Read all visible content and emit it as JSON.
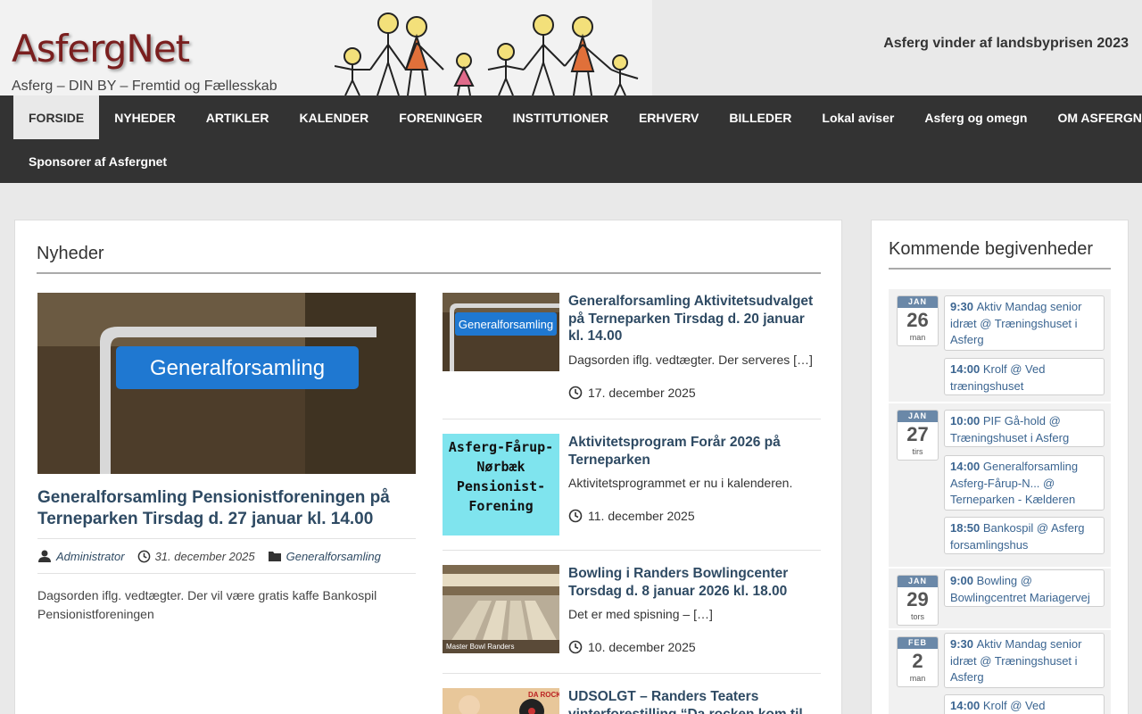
{
  "header": {
    "site_title": "AsfergNet",
    "tagline": "Asferg – DIN BY – Fremtid og Fællesskab",
    "notice": "Asferg vinder af landsbyprisen 2023"
  },
  "nav": {
    "row1": [
      "FORSIDE",
      "NYHEDER",
      "ARTIKLER",
      "KALENDER",
      "FORENINGER",
      "INSTITUTIONER",
      "ERHVERV",
      "BILLEDER",
      "Lokal aviser",
      "Asferg og omegn",
      "OM ASFERGNET"
    ],
    "row2": [
      "Sponsorer af Asfergnet"
    ],
    "active": "FORSIDE"
  },
  "news": {
    "section_title": "Nyheder",
    "featured": {
      "image_sign_text": "Generalforsamling",
      "title": "Generalforsamling Pensionistforeningen på Terneparken Tirsdag d. 27 januar kl. 14.00",
      "author": "Administrator",
      "date": "31. december 2025",
      "category": "Generalforsamling",
      "excerpt": "Dagsorden iflg. vedtægter. Der vil være gratis kaffe Bankospil Pensionistforeningen"
    },
    "posts": [
      {
        "thumb_text": "Generalforsamling",
        "title": "Generalforsamling Aktivitetsudvalget på Terneparken Tirsdag d. 20 januar kl. 14.00",
        "excerpt": "Dagsorden iflg. vedtægter. Der serveres […]",
        "date": "17. december 2025"
      },
      {
        "thumb_text": "Asferg-Fårup-Nørbæk Pensionist-Forening",
        "title": "Aktivitetsprogram Forår 2026 på Terneparken",
        "excerpt": "Aktivitetsprogrammet er nu i kalenderen.",
        "date": "11. december 2025"
      },
      {
        "thumb_text": "Master Bowl Randers",
        "title": "Bowling i Randers Bowlingcenter Torsdag d. 8 januar 2026 kl. 18.00",
        "excerpt": "Det er med spisning – […]",
        "date": "10. december 2025"
      },
      {
        "thumb_text": "DA ROCKEN",
        "title": "UDSOLGT – Randers Teaters vinterforestilling “Da rocken kom til",
        "excerpt": "",
        "date": ""
      }
    ]
  },
  "sidebar": {
    "title": "Kommende begivenheder",
    "days": [
      {
        "month": "JAN",
        "day": "26",
        "weekday": "man",
        "events": [
          {
            "time": "9:30",
            "text": "Aktiv Mandag senior idræt @ Træningshuset i Asferg"
          },
          {
            "time": "14:00",
            "text": "Krolf @ Ved træningshuset"
          }
        ]
      },
      {
        "month": "JAN",
        "day": "27",
        "weekday": "tirs",
        "events": [
          {
            "time": "10:00",
            "text": "PIF Gå-hold @ Træningshuset i Asferg"
          },
          {
            "time": "14:00",
            "text": "Generalforsamling Asferg-Fårup-N... @ Terneparken - Kælderen"
          },
          {
            "time": "18:50",
            "text": "Bankospil @ Asferg forsamlingshus"
          }
        ]
      },
      {
        "month": "JAN",
        "day": "29",
        "weekday": "tors",
        "events": [
          {
            "time": "9:00",
            "text": "Bowling @ Bowlingcentret Mariagervej"
          }
        ]
      },
      {
        "month": "FEB",
        "day": "2",
        "weekday": "man",
        "events": [
          {
            "time": "9:30",
            "text": "Aktiv Mandag senior idræt @ Træningshuset i Asferg"
          },
          {
            "time": "14:00",
            "text": "Krolf @ Ved"
          }
        ]
      }
    ]
  }
}
